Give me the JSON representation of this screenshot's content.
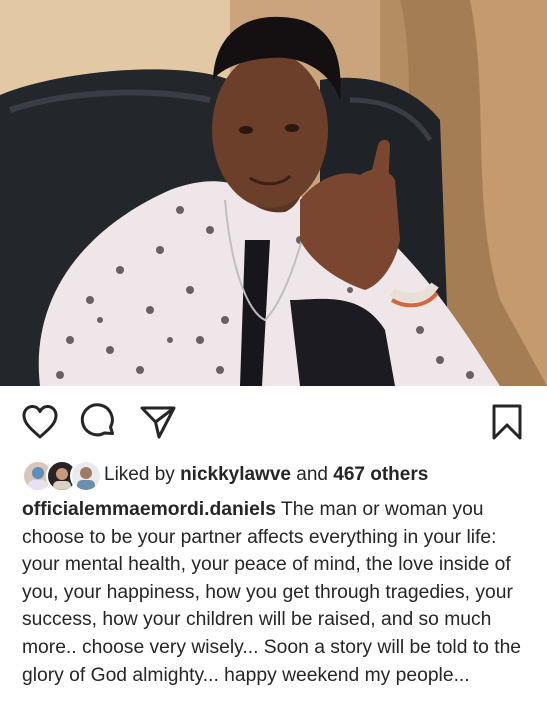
{
  "post": {
    "photo_description_icon": "portrait-photo",
    "actions": {
      "like_icon": "heart-icon",
      "comment_icon": "comment-icon",
      "share_icon": "send-icon",
      "save_icon": "bookmark-icon"
    },
    "likes": {
      "prefix": "Liked by",
      "user": "nickkylawve",
      "joiner": "and",
      "others": "467 others"
    },
    "caption": {
      "username": "officialemmaemordi.daniels",
      "text": "The man or woman you choose to be your partner affects everything in your life: your mental health, your peace of mind, the love inside of you, your happiness, how you get through tragedies, your success, how your children will be raised, and so much more.. choose very wisely... Soon a story will be told to the glory of God almighty... happy weekend my people..."
    }
  }
}
